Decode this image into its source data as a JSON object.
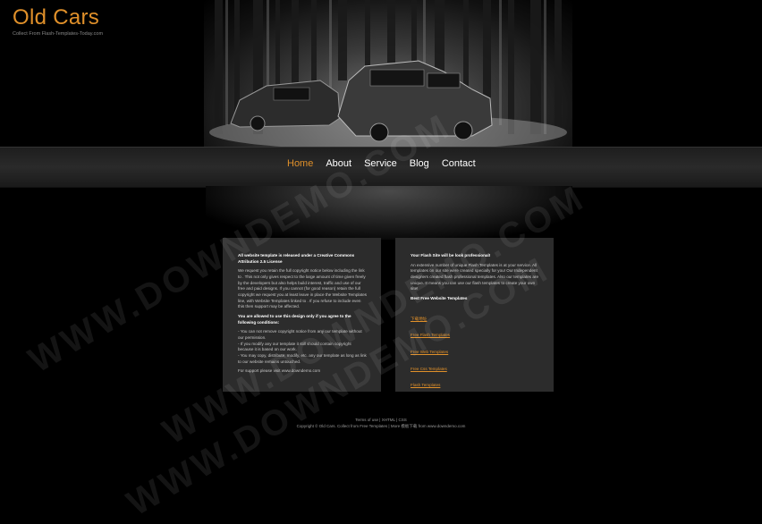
{
  "site": {
    "title": "Old Cars",
    "tagline": "Collect From Flash-Templates-Today.com"
  },
  "nav": [
    "Home",
    "About",
    "Service",
    "Blog",
    "Contact"
  ],
  "left_column": {
    "heading": "All website template is released under a Creative Commons Attribution 2.5 License",
    "para1": "We request you retain the full copyright notice below including the link to . This not only gives respect to the large amount of time given freely by the developers but also helps build interest, traffic and use of our free and paid designs. If you cannot (for good reason) retain the full copyright we request you at least leave in place the Website Templates line, with Website Templates linked to . If you refuse to include even this then support may be affected.",
    "subheading": "You are allowed to use this design only if you agree to the following conditions:",
    "conditions": [
      "- You can not remove copyright notice from any our template without our permission.",
      "- If you modify any our template it still should contain copyright because it is based on our work.",
      "- You may copy, distribute, modify, etc. any our template as long as link to our website remains untouched."
    ],
    "support": "For support please visit www.downdemo.com"
  },
  "right_column": {
    "heading": "Your Flash Site will be look professional!",
    "para": "An extensive number of unique Flash Templates is at your service. All templates on our site were created specially for you! Our Independent designers created flash professional templates. Also our templates are unique. It means you can use our flash templates to create your own site!",
    "links_heading": "Best Free Website Templates",
    "links": [
      "下载地址",
      "Free Flash Templates",
      "Free Web Templates",
      "Free Css Templates",
      "Flash Templates"
    ]
  },
  "footer": {
    "line1": "Terms of use | XHTML | CSS",
    "line2": "Copyright © Old Cars. Collect from Free Templates | More 模板下载 from www.downdemo.com"
  },
  "watermark": "WWW.DOWNDEMO.COM"
}
